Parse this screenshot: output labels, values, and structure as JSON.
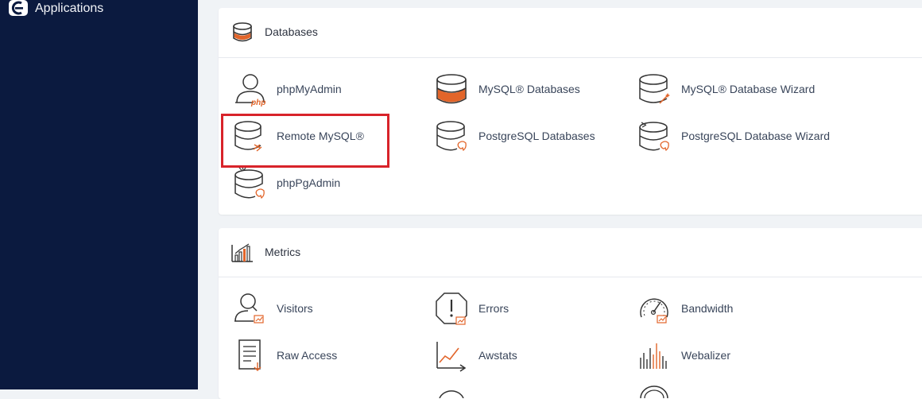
{
  "sidebar": {
    "applications_label": "Applications"
  },
  "databases": {
    "title": "Databases",
    "items": [
      {
        "label": "phpMyAdmin",
        "icon": "phpmyadmin-icon"
      },
      {
        "label": "MySQL® Databases",
        "icon": "mysql-databases-icon"
      },
      {
        "label": "MySQL® Database Wizard",
        "icon": "mysql-wizard-icon"
      },
      {
        "label": "Remote MySQL®",
        "icon": "remote-mysql-icon"
      },
      {
        "label": "PostgreSQL Databases",
        "icon": "postgresql-databases-icon"
      },
      {
        "label": "PostgreSQL Database Wizard",
        "icon": "postgresql-wizard-icon"
      },
      {
        "label": "phpPgAdmin",
        "icon": "phppgadmin-icon"
      }
    ]
  },
  "metrics": {
    "title": "Metrics",
    "items": [
      {
        "label": "Visitors",
        "icon": "visitors-icon"
      },
      {
        "label": "Errors",
        "icon": "errors-icon"
      },
      {
        "label": "Bandwidth",
        "icon": "bandwidth-icon"
      },
      {
        "label": "Raw Access",
        "icon": "raw-access-icon"
      },
      {
        "label": "Awstats",
        "icon": "awstats-icon"
      },
      {
        "label": "Webalizer",
        "icon": "webalizer-icon"
      }
    ]
  },
  "colors": {
    "sidebar_bg": "#0b1a3f",
    "accent_orange": "#e2652a",
    "highlight_red": "#d8232a"
  }
}
